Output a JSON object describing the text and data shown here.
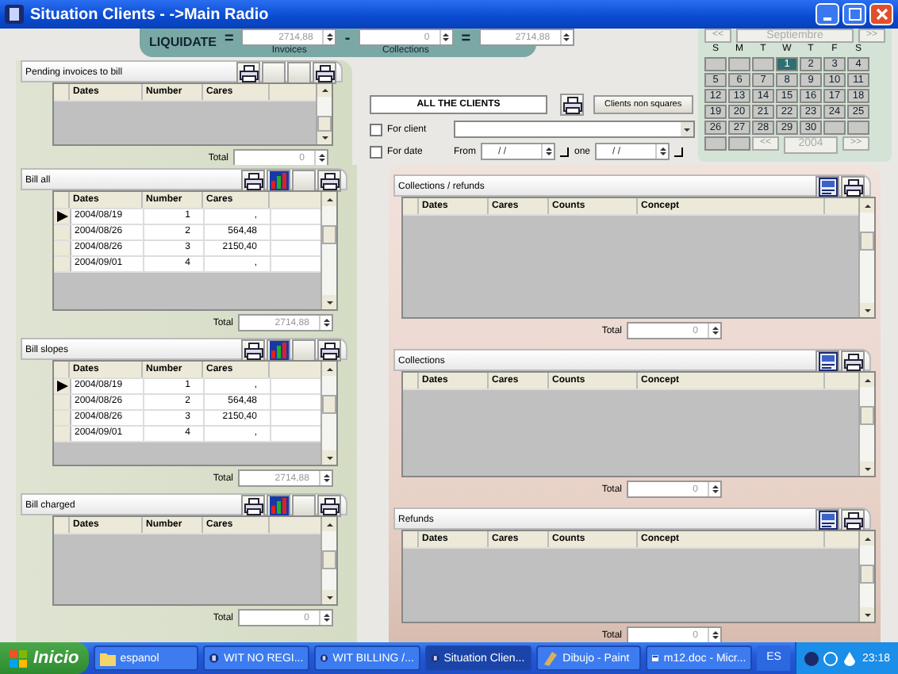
{
  "window": {
    "title": "Situation Clients - ->Main Radio"
  },
  "liquidate": {
    "label": "LIQUIDATE",
    "op1": "=",
    "invoices": {
      "value": "2714,88",
      "caption": "Invoices"
    },
    "op2": "-",
    "collections": {
      "value": "0",
      "caption": "Collections"
    },
    "op3": "=",
    "result": "2714,88"
  },
  "filter": {
    "scope": "ALL THE CLIENTS",
    "button": "Clients non squares",
    "for_client": {
      "label": "For client",
      "checked": false
    },
    "for_date": {
      "label": "For date",
      "checked": false
    },
    "from_label": "From",
    "from_value": "/  /",
    "to_label": "one",
    "to_value": "/  /"
  },
  "calendar": {
    "prev": "<<",
    "month": "Septiembre",
    "next": ">>",
    "weekdays": [
      "S",
      "M",
      "T",
      "W",
      "T",
      "F",
      "S"
    ],
    "days": [
      {
        "kind": "blank"
      },
      {
        "kind": "blank"
      },
      {
        "kind": "blank"
      },
      {
        "kind": "day",
        "day": "1",
        "selected": true
      },
      {
        "kind": "day",
        "day": "2",
        "selected": false
      },
      {
        "kind": "day",
        "day": "3",
        "selected": false
      },
      {
        "kind": "day",
        "day": "4",
        "selected": false
      },
      {
        "kind": "day",
        "day": "5",
        "selected": false
      },
      {
        "kind": "day",
        "day": "6",
        "selected": false
      },
      {
        "kind": "day",
        "day": "7",
        "selected": false
      },
      {
        "kind": "day",
        "day": "8",
        "selected": false
      },
      {
        "kind": "day",
        "day": "9",
        "selected": false
      },
      {
        "kind": "day",
        "day": "10",
        "selected": false
      },
      {
        "kind": "day",
        "day": "11",
        "selected": false
      },
      {
        "kind": "day",
        "day": "12",
        "selected": false
      },
      {
        "kind": "day",
        "day": "13",
        "selected": false
      },
      {
        "kind": "day",
        "day": "14",
        "selected": false
      },
      {
        "kind": "day",
        "day": "15",
        "selected": false
      },
      {
        "kind": "day",
        "day": "16",
        "selected": false
      },
      {
        "kind": "day",
        "day": "17",
        "selected": false
      },
      {
        "kind": "day",
        "day": "18",
        "selected": false
      },
      {
        "kind": "day",
        "day": "19",
        "selected": false
      },
      {
        "kind": "day",
        "day": "20",
        "selected": false
      },
      {
        "kind": "day",
        "day": "21",
        "selected": false
      },
      {
        "kind": "day",
        "day": "22",
        "selected": false
      },
      {
        "kind": "day",
        "day": "23",
        "selected": false
      },
      {
        "kind": "day",
        "day": "24",
        "selected": false
      },
      {
        "kind": "day",
        "day": "25",
        "selected": false
      },
      {
        "kind": "day",
        "day": "26",
        "selected": false
      },
      {
        "kind": "day",
        "day": "27",
        "selected": false
      },
      {
        "kind": "day",
        "day": "28",
        "selected": false
      },
      {
        "kind": "day",
        "day": "29",
        "selected": false
      },
      {
        "kind": "day",
        "day": "30",
        "selected": false
      },
      {
        "kind": "blank"
      },
      {
        "kind": "blank"
      }
    ],
    "year_prev": "<<",
    "year": "2004",
    "year_next": ">>"
  },
  "left_sections": [
    {
      "title": "Pending invoices to bill",
      "tools": [
        {
          "kind": "print"
        },
        {
          "kind": "blank"
        },
        {
          "kind": "blank"
        },
        {
          "kind": "print"
        }
      ],
      "columns": [
        "Dates",
        "Number",
        "Cares"
      ],
      "total_label": "Total",
      "total": "0"
    },
    {
      "title": "Bill all",
      "tools": [
        {
          "kind": "print"
        },
        {
          "kind": "chart"
        },
        {
          "kind": "blank"
        },
        {
          "kind": "print"
        }
      ],
      "columns": [
        "Dates",
        "Number",
        "Cares"
      ],
      "rows": [
        {
          "selected": true,
          "cells": [
            "2004/08/19",
            "1",
            ","
          ]
        },
        {
          "selected": false,
          "cells": [
            "2004/08/26",
            "2",
            "564,48"
          ]
        },
        {
          "selected": false,
          "cells": [
            "2004/08/26",
            "3",
            "2150,40"
          ]
        },
        {
          "selected": false,
          "cells": [
            "2004/09/01",
            "4",
            ","
          ]
        }
      ],
      "total_label": "Total",
      "total": "2714,88"
    },
    {
      "title": "Bill slopes",
      "tools": [
        {
          "kind": "print"
        },
        {
          "kind": "chart"
        },
        {
          "kind": "blank"
        },
        {
          "kind": "print"
        }
      ],
      "columns": [
        "Dates",
        "Number",
        "Cares"
      ],
      "rows": [
        {
          "selected": true,
          "cells": [
            "2004/08/19",
            "1",
            ","
          ]
        },
        {
          "selected": false,
          "cells": [
            "2004/08/26",
            "2",
            "564,48"
          ]
        },
        {
          "selected": false,
          "cells": [
            "2004/08/26",
            "3",
            "2150,40"
          ]
        },
        {
          "selected": false,
          "cells": [
            "2004/09/01",
            "4",
            ","
          ]
        }
      ],
      "total_label": "Total",
      "total": "2714,88"
    },
    {
      "title": "Bill charged",
      "tools": [
        {
          "kind": "print"
        },
        {
          "kind": "chart"
        },
        {
          "kind": "blank"
        },
        {
          "kind": "print"
        }
      ],
      "columns": [
        "Dates",
        "Number",
        "Cares"
      ],
      "total_label": "Total",
      "total": "0"
    }
  ],
  "right_sections": [
    {
      "title": "Collections / refunds",
      "tools": [
        {
          "kind": "export"
        },
        {
          "kind": "print"
        }
      ],
      "columns": [
        "Dates",
        "Cares",
        "Counts",
        "Concept"
      ],
      "total_label": "Total",
      "total": "0"
    },
    {
      "title": "Collections",
      "tools": [
        {
          "kind": "export"
        },
        {
          "kind": "print"
        }
      ],
      "columns": [
        "Dates",
        "Cares",
        "Counts",
        "Concept"
      ],
      "total_label": "Total",
      "total": "0"
    },
    {
      "title": "Refunds",
      "tools": [
        {
          "kind": "export"
        },
        {
          "kind": "print"
        }
      ],
      "columns": [
        "Dates",
        "Cares",
        "Counts",
        "Concept"
      ],
      "total_label": "Total",
      "total": "0"
    }
  ],
  "taskbar": {
    "start": "Inicio",
    "tasks": [
      {
        "label": "espanol",
        "kind": "folder",
        "selected": false
      },
      {
        "label": "WIT NO REGI...",
        "kind": "app",
        "selected": false
      },
      {
        "label": "WIT BILLING /...",
        "kind": "app",
        "selected": false
      },
      {
        "label": "Situation Clien...",
        "kind": "app",
        "selected": true
      },
      {
        "label": "Dibujo - Paint",
        "kind": "paint",
        "selected": false
      },
      {
        "label": "m12.doc - Micr...",
        "kind": "doc",
        "selected": false
      }
    ],
    "language": "ES",
    "clock": "23:18"
  }
}
